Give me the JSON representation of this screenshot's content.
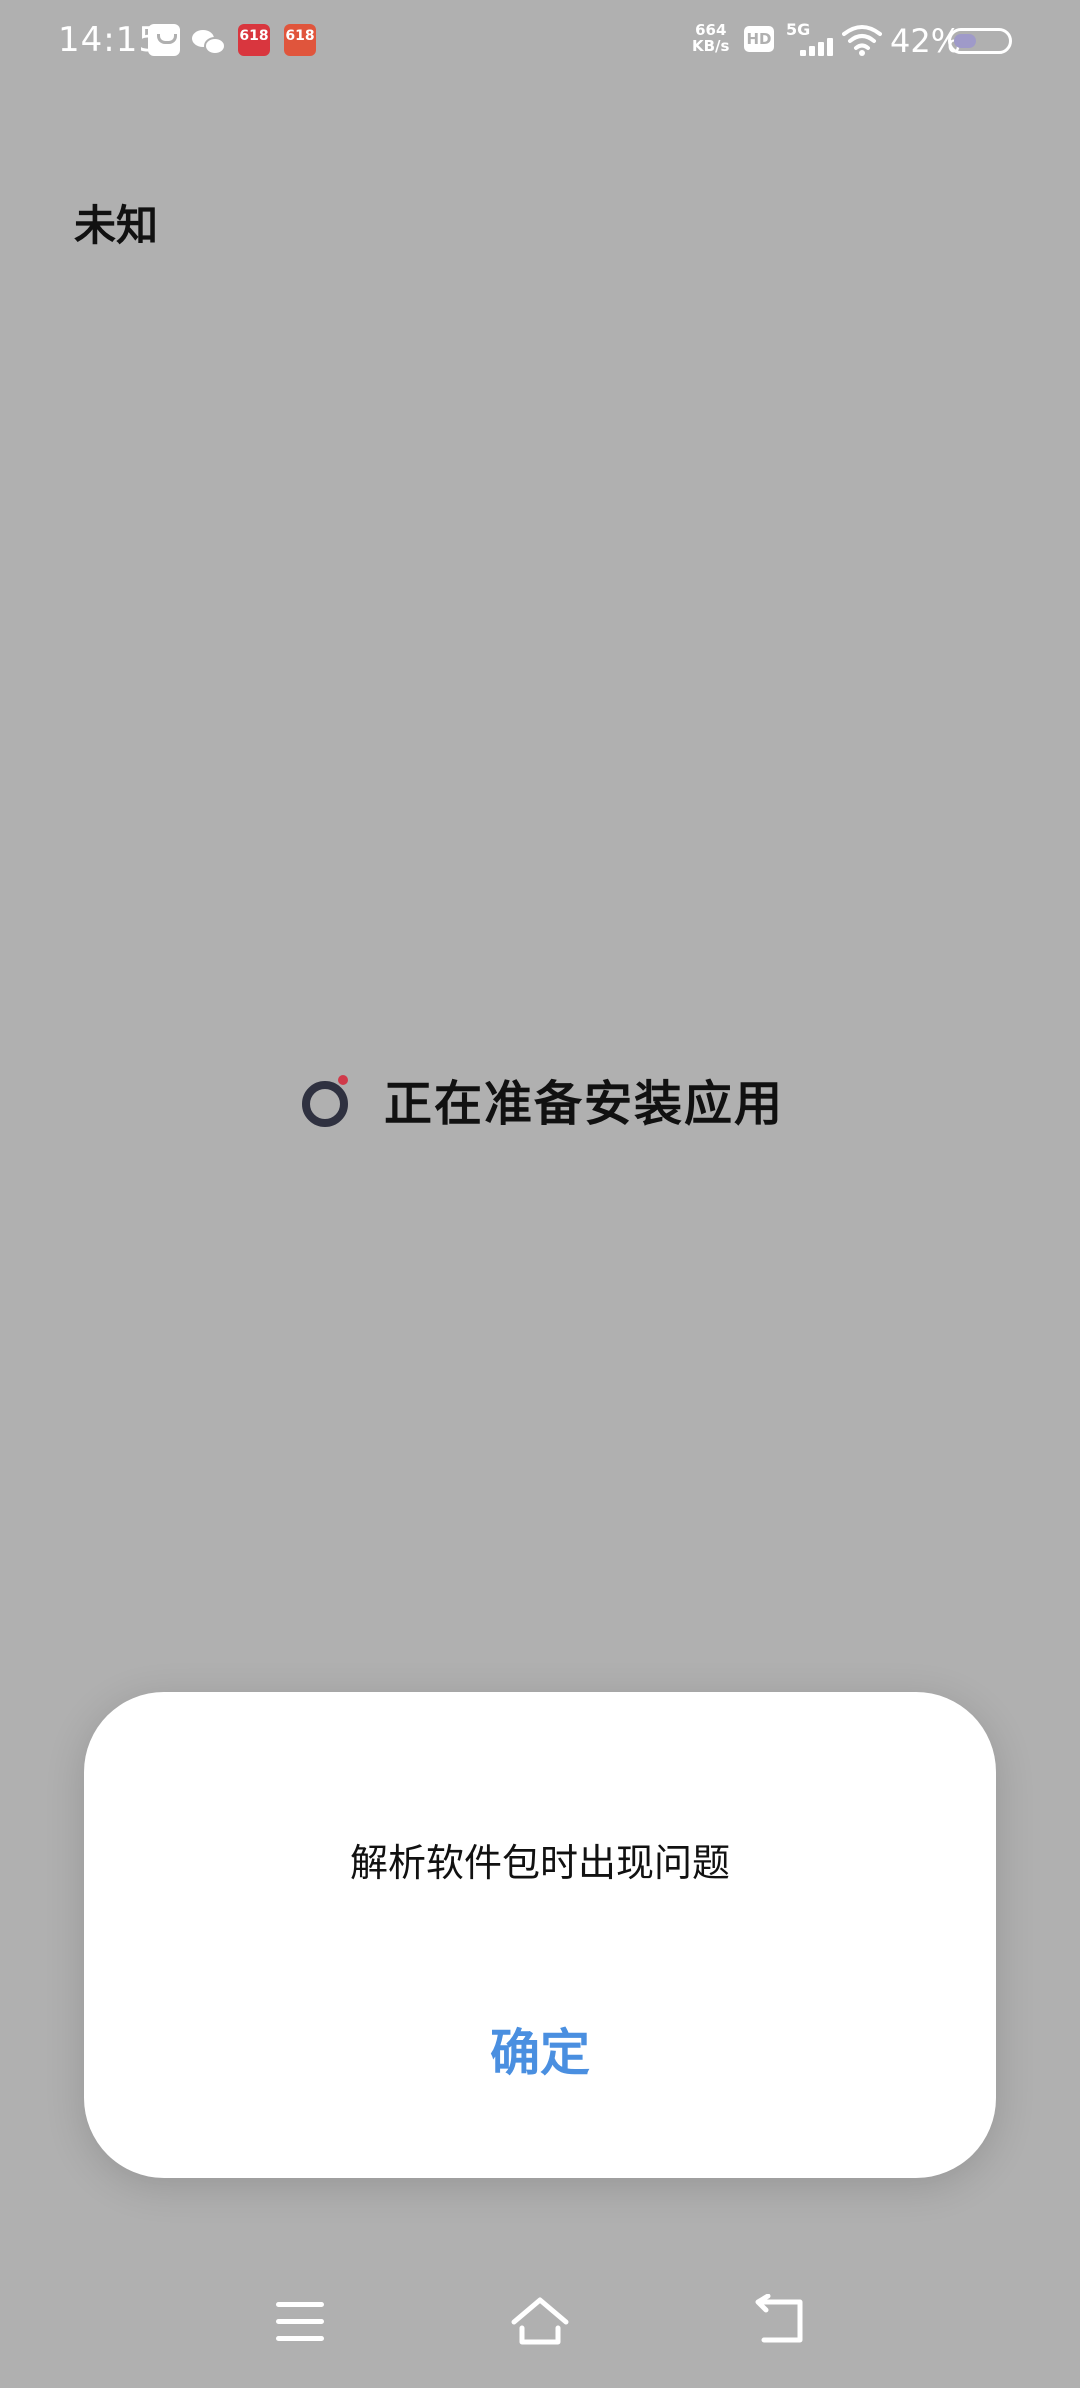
{
  "status_bar": {
    "time": "14:15",
    "network_speed_value": "664",
    "network_speed_unit": "KB/s",
    "hd_label": "HD",
    "network_type": "5G",
    "battery_percent": "42%",
    "battery_level": 0.42,
    "notification_icons": [
      "shopping-bag-icon",
      "wechat-icon",
      "app-icon-1",
      "app-icon-2"
    ],
    "app1_label": "618",
    "app2_label": "618"
  },
  "page": {
    "app_name": "未知",
    "loading_text": "正在准备安装应用"
  },
  "dialog": {
    "message": "解析软件包时出现问题",
    "confirm_label": "确定"
  },
  "colors": {
    "background": "#b0b0b0",
    "dialog_bg": "#ffffff",
    "accent": "#4a8fe0",
    "spinner_dot": "#d03a4a"
  }
}
